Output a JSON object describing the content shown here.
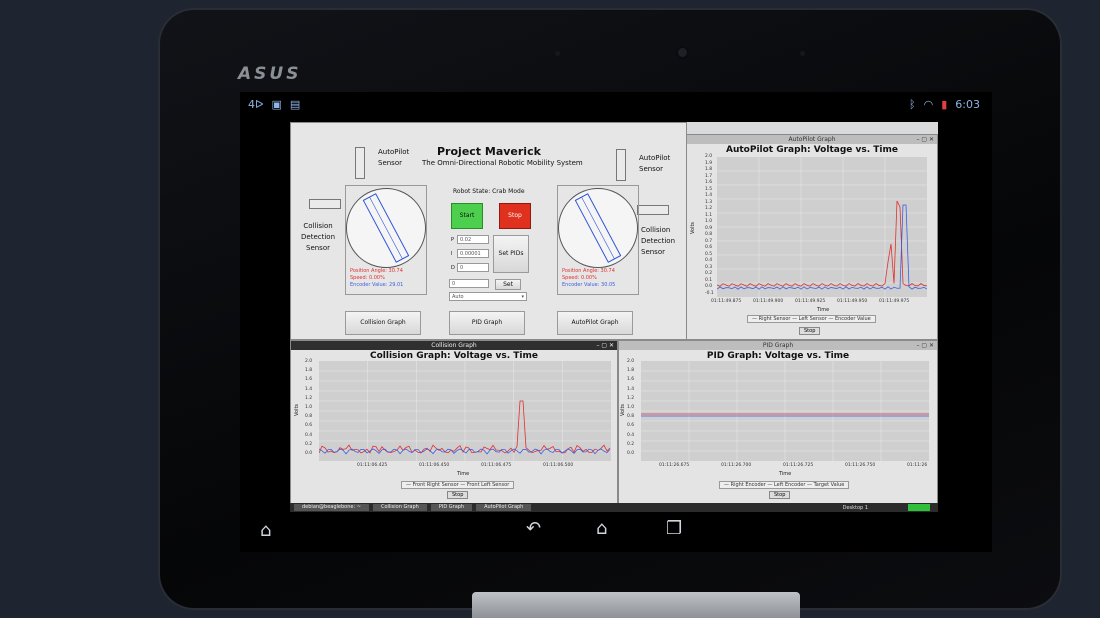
{
  "device": {
    "brand": "ASUS"
  },
  "android_status": {
    "time": "6:03",
    "left_icons": [
      "notification-icon",
      "sim-icon",
      "file-icon"
    ],
    "right_icons": [
      "bluetooth-icon",
      "wifi-icon",
      "battery-icon"
    ]
  },
  "main_window": {
    "title": "Project Maverick",
    "subtitle": "The Omni-Directional Robotic Mobility System",
    "robot_state": "Robot State: Crab Mode",
    "left_sensor_label": [
      "AutoPilot",
      "Sensor"
    ],
    "right_sensor_label": [
      "AutoPilot",
      "Sensor"
    ],
    "left_collision_label": [
      "Collision",
      "Detection",
      "Sensor"
    ],
    "right_collision_label": [
      "Collision",
      "Detection",
      "Sensor"
    ],
    "start_label": "Start",
    "stop_label": "Stop",
    "pid_fields": [
      {
        "label": "P",
        "value": "0.02"
      },
      {
        "label": "I",
        "value": "0.00001"
      },
      {
        "label": "D",
        "value": "0"
      }
    ],
    "set_pids_label": "Set PIDs",
    "set_field_value": "0",
    "set_label": "Set",
    "mode_select": "Auto",
    "left_stats": [
      "Position Angle: 30.74",
      "Speed: 0.00%",
      "Encoder Value: 29.01"
    ],
    "right_stats": [
      "Position Angle: 30.74",
      "Speed: 0.00%",
      "Encoder Value: 30.05"
    ],
    "buttons": {
      "collision": "Collision Graph",
      "pid": "PID Graph",
      "autopilot": "AutoPilot Graph"
    }
  },
  "autopilot_window": {
    "window_title": "AutoPilot Graph",
    "graph_title": "AutoPilot Graph: Voltage vs. Time",
    "ylabel": "Volts",
    "xlabel": "Time",
    "legend": "— Right Sensor — Left Sensor — Encoder Value",
    "stop": "Stop",
    "xticks": [
      "01:11:49.875",
      "01:11:49.900",
      "01:11:49.925",
      "01:11:49.950",
      "01:11:49.975"
    ],
    "yticks": [
      "2.0",
      "1.9",
      "1.8",
      "1.7",
      "1.6",
      "1.5",
      "1.4",
      "1.3",
      "1.2",
      "1.1",
      "1.0",
      "0.9",
      "0.8",
      "0.7",
      "0.6",
      "0.5",
      "0.4",
      "0.3",
      "0.2",
      "0.1",
      "0.0",
      "-0.1"
    ]
  },
  "collision_window": {
    "window_title": "Collision Graph",
    "graph_title": "Collision Graph: Voltage vs. Time",
    "ylabel": "Volts",
    "xlabel": "Time",
    "legend": "— Front Right Sensor — Front Left Sensor",
    "stop": "Stop",
    "xticks": [
      "01:11:06.425",
      "01:11:06.450",
      "01:11:06.475",
      "01:11:06.500"
    ],
    "yticks": [
      "2.0",
      "1.8",
      "1.6",
      "1.4",
      "1.2",
      "1.0",
      "0.8",
      "0.6",
      "0.4",
      "0.2",
      "0.0"
    ]
  },
  "pid_window": {
    "window_title": "PID Graph",
    "graph_title": "PID Graph: Voltage vs. Time",
    "ylabel": "Volts",
    "xlabel": "Time",
    "legend": "— Right Encoder — Left Encoder — Target Value",
    "stop": "Stop",
    "xticks": [
      "01:11:26.675",
      "01:11:26.700",
      "01:11:26.725",
      "01:11:26.750",
      "01:11:26"
    ],
    "yticks": [
      "2.0",
      "1.8",
      "1.6",
      "1.4",
      "1.2",
      "1.0",
      "0.8",
      "0.6",
      "0.4",
      "0.2",
      "0.0"
    ]
  },
  "taskbar": {
    "items": [
      "debian@beaglebone: ~",
      "Collision Graph",
      "PID Graph",
      "AutoPilot Graph"
    ],
    "desktop": "Desktop 1"
  },
  "colors": {
    "red": "#e03030",
    "blue": "#3a5fe0",
    "start": "#4ccf4c",
    "stop": "#e0301e"
  }
}
